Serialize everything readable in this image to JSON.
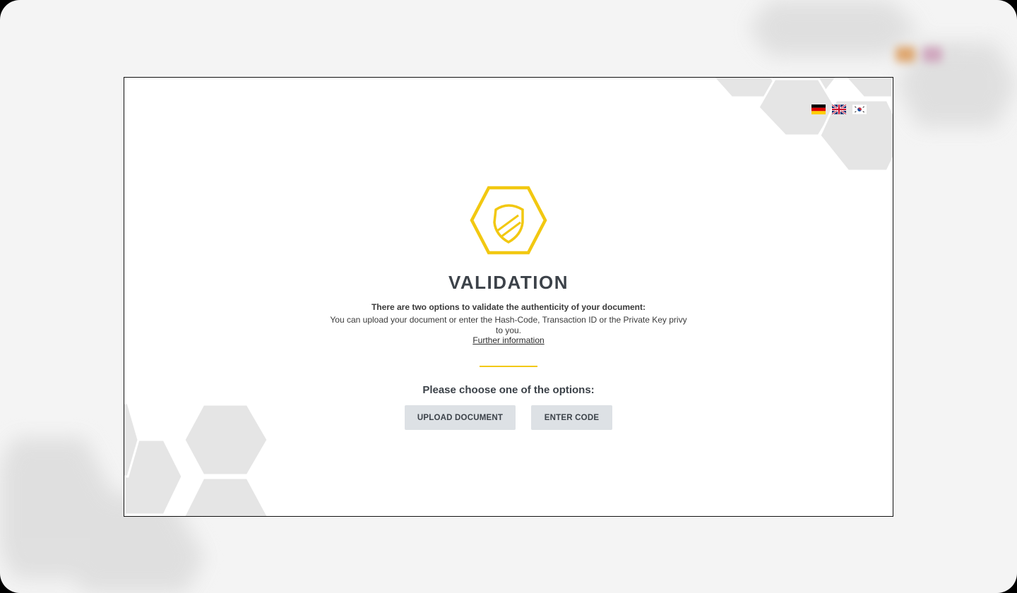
{
  "languages": [
    {
      "code": "de",
      "icon": "german-flag-icon"
    },
    {
      "code": "en",
      "icon": "uk-flag-icon"
    },
    {
      "code": "ko",
      "icon": "korean-flag-icon"
    }
  ],
  "colors": {
    "accent": "#f2c811",
    "heading": "#3c4249",
    "button_bg": "#dde1e5",
    "hexagon_deco": "#e5e5e5"
  },
  "validation": {
    "logo_icon": "shield-hexagon-icon",
    "title": "VALIDATION",
    "intro_bold": "There are two options to validate the authenticity of your document:",
    "intro_text": "You can upload your document or enter the Hash-Code, Transaction ID or the Private Key privy to you.",
    "further_link": "Further information",
    "choose_prompt": "Please choose one of the options:",
    "upload_button": "UPLOAD DOCUMENT",
    "code_button": "ENTER CODE"
  }
}
